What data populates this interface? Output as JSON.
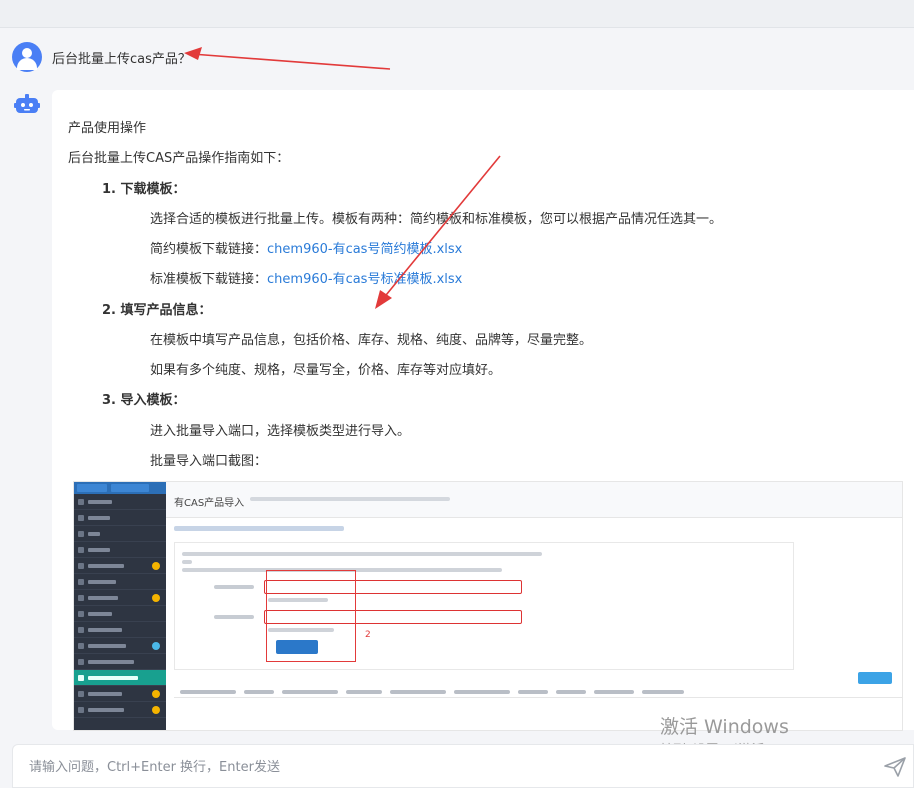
{
  "user_question": "后台批量上传cas产品？",
  "answer": {
    "heading": "产品使用操作",
    "intro": "后台批量上传CAS产品操作指南如下：",
    "steps": [
      {
        "title": "1. 下载模板：",
        "lines": [
          "选择合适的模板进行批量上传。模板有两种：简约模板和标准模板，您可以根据产品情况任选其一。"
        ],
        "simple_label": "简约模板下载链接：",
        "simple_link": "chem960-有cas号简约模板.xlsx",
        "standard_label": "标准模板下载链接：",
        "standard_link": "chem960-有cas号标准模板.xlsx"
      },
      {
        "title": "2. 填写产品信息：",
        "lines": [
          "在模板中填写产品信息，包括价格、库存、规格、纯度、品牌等，尽量完整。",
          "如果有多个纯度、规格，尽量写全，价格、库存等对应填好。"
        ]
      },
      {
        "title": "3. 导入模板：",
        "lines": [
          "进入批量导入端口，选择模板类型进行导入。",
          "批量导入端口截图："
        ]
      }
    ]
  },
  "screenshot": {
    "title": "有CAS产品导入",
    "annotation_number": "2"
  },
  "watermark": {
    "line1": "激活 Windows",
    "line2": "转到“设置”以激活 Windows。"
  },
  "input": {
    "placeholder": "请输入问题，Ctrl+Enter 换行，Enter发送"
  },
  "colors": {
    "accent": "#4a7ff5",
    "link": "#2a7bd8",
    "arrow": "#e23a3a"
  }
}
